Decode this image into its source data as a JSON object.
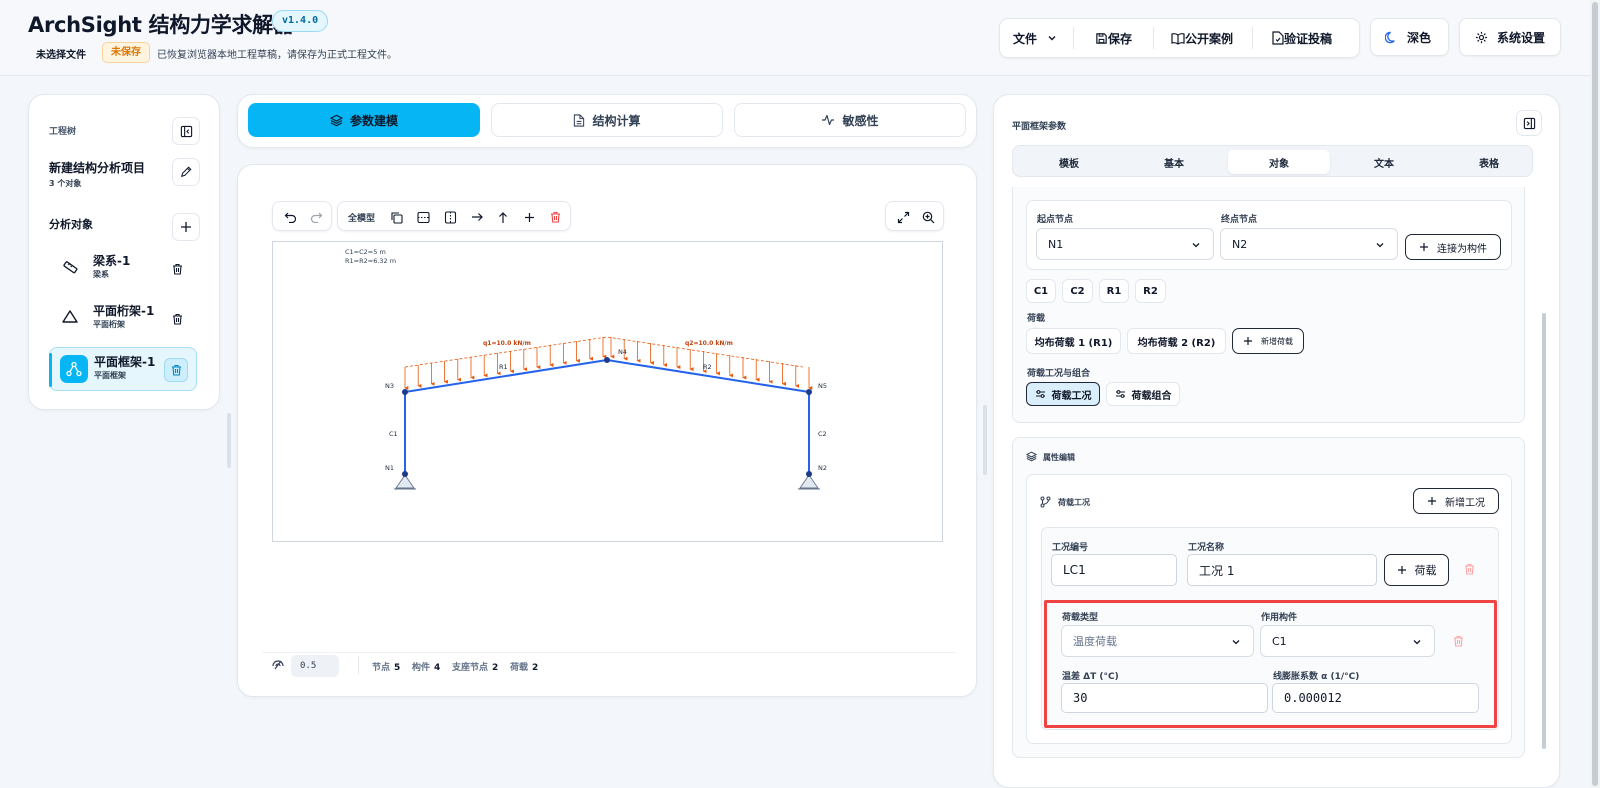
{
  "header": {
    "app_title": "ArchSight 结构力学求解器",
    "version": "v1.4.0",
    "file_status": "未选择文件",
    "unsaved_badge": "未保存",
    "restore_notice": "已恢复浏览器本地工程草稿，请保存为正式工程文件。",
    "menu_file": "文件",
    "save": "保存",
    "public_cases": "公开案例",
    "verify_submit": "验证投稿",
    "dark_mode": "深色",
    "settings": "系统设置"
  },
  "left_panel": {
    "section_title": "工程树",
    "project_name": "新建结构分析项目",
    "object_count": "3 个对象",
    "objects_title": "分析对象",
    "items": [
      {
        "name": "梁系-1",
        "type": "梁系",
        "icon": "beam-icon"
      },
      {
        "name": "平面桁架-1",
        "type": "平面桁架",
        "icon": "triangle-icon"
      },
      {
        "name": "平面框架-1",
        "type": "平面框架",
        "icon": "frame-icon",
        "selected": true
      }
    ]
  },
  "main_tabs": [
    {
      "label": "参数建模",
      "active": true,
      "icon": "layers-icon"
    },
    {
      "label": "结构计算",
      "active": false,
      "icon": "document-icon"
    },
    {
      "label": "敏感性",
      "active": false,
      "icon": "pulse-icon"
    }
  ],
  "toolbar": {
    "full_model": "全模型"
  },
  "drawing": {
    "dim_line1": "C1=C2=5 m",
    "dim_line2": "R1=R2=6.32 m",
    "q1": "q1=10.0 kN/m",
    "q2": "q2=10.0 kN/m",
    "nodes": [
      "N1",
      "N2",
      "N3",
      "N4",
      "N5"
    ],
    "members": [
      "C1",
      "C2",
      "R1",
      "R2"
    ]
  },
  "footer": {
    "scale_value": "0.5",
    "nodes_label": "节点",
    "nodes_value": "5",
    "members_label": "构件",
    "members_value": "4",
    "supports_label": "支座节点",
    "supports_value": "2",
    "loads_label": "荷载",
    "loads_value": "2"
  },
  "right_panel": {
    "title": "平面框架参数",
    "subtabs": [
      {
        "label": "模板",
        "active": false
      },
      {
        "label": "基本",
        "active": false
      },
      {
        "label": "对象",
        "active": true
      },
      {
        "label": "文本",
        "active": false
      },
      {
        "label": "表格",
        "active": false
      }
    ],
    "start_node_label": "起点节点",
    "start_node_value": "N1",
    "end_node_label": "终点节点",
    "end_node_value": "N2",
    "connect_button": "连接为构件",
    "member_chips": [
      "C1",
      "C2",
      "R1",
      "R2"
    ],
    "loads_label": "荷载",
    "load_chips": [
      "均布荷载 1 (R1)",
      "均布荷载 2 (R2)"
    ],
    "add_load": "新增荷载",
    "cases_label": "荷载工况与组合",
    "case_button": "荷载工况",
    "combo_button": "荷载组合",
    "prop_edit_title": "属性编辑",
    "load_case_title": "荷载工况",
    "add_case": "新增工况",
    "case_id_label": "工况编号",
    "case_id_value": "LC1",
    "case_name_label": "工况名称",
    "case_name_value": "工况 1",
    "add_load_to_case": "荷载",
    "load_type_label": "荷载类型",
    "load_type_value": "温度荷载",
    "acting_member_label": "作用构件",
    "acting_member_value": "C1",
    "temp_diff_label": "温差 ΔT (°C)",
    "temp_diff_value": "30",
    "expansion_label": "线膨胀系数 α (1/°C)",
    "expansion_value": "0.000012"
  },
  "colors": {
    "accent": "#06b6f4",
    "frame_line": "#2563eb",
    "load_arrow": "#ea580c",
    "highlight_border": "#ef4444",
    "unsaved_text": "#d97706"
  }
}
